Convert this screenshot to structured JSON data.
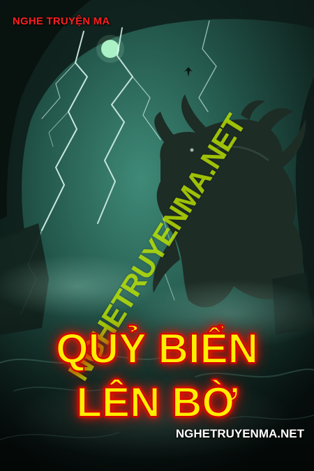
{
  "cover": {
    "brand_top": "NGHE TRUYỆN MA",
    "watermark": "NGHETRUYENMA.NET",
    "title_line_1": "QUỶ BIỂN",
    "title_line_2": "LÊN BỜ",
    "brand_bottom": "NGHETRUYENMA.NET"
  },
  "colors": {
    "brand_top": "#ff1f1f",
    "watermark": "#bfe600",
    "title_fill": "#ffee00",
    "title_glow": "#ff1a00",
    "brand_bottom": "#ffffff",
    "background": "#0b1714"
  },
  "illustration": {
    "subject": "sea-monster-in-storm",
    "elements": [
      "lightning-bolts",
      "moon",
      "sea-monster",
      "waves"
    ]
  }
}
